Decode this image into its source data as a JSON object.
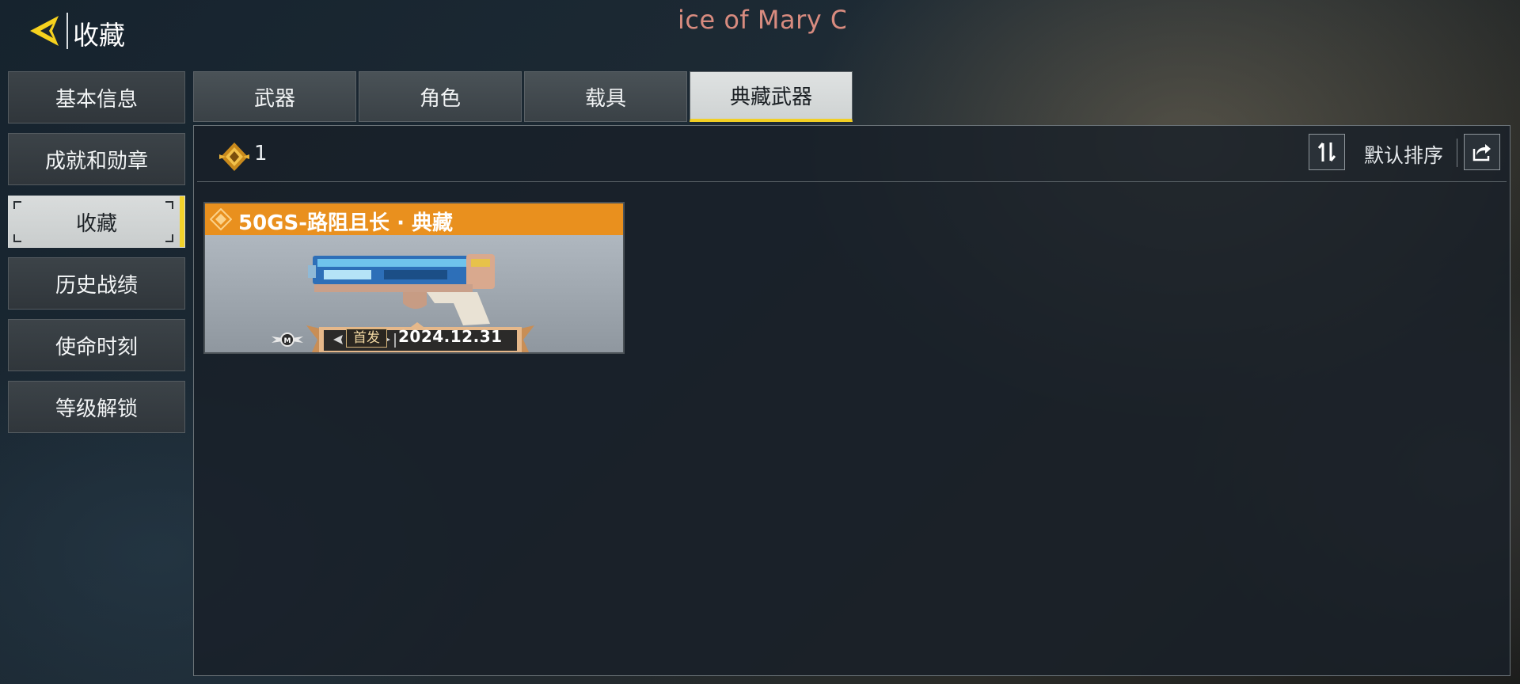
{
  "header": {
    "back_label": "收藏",
    "marquee_text": "ice of Mary Co"
  },
  "sidebar": {
    "items": [
      {
        "label": "基本信息",
        "active": false
      },
      {
        "label": "成就和勋章",
        "active": false
      },
      {
        "label": "收藏",
        "active": true
      },
      {
        "label": "历史战绩",
        "active": false
      },
      {
        "label": "使命时刻",
        "active": false
      },
      {
        "label": "等级解锁",
        "active": false
      }
    ]
  },
  "tabs": [
    {
      "label": "武器",
      "active": false
    },
    {
      "label": "角色",
      "active": false
    },
    {
      "label": "载具",
      "active": false
    },
    {
      "label": "典藏武器",
      "active": true
    }
  ],
  "toolbar": {
    "count": "1",
    "sort_label": "默认排序"
  },
  "cards": [
    {
      "title": "50GS-路阻且长 · 典藏",
      "badge": "首发",
      "date": "2024.12.31",
      "rarity_color": "#e9901e"
    }
  ],
  "colors": {
    "accent": "#f3d22b",
    "card_header": "#e9901e",
    "marquee": "#d88b7f"
  }
}
